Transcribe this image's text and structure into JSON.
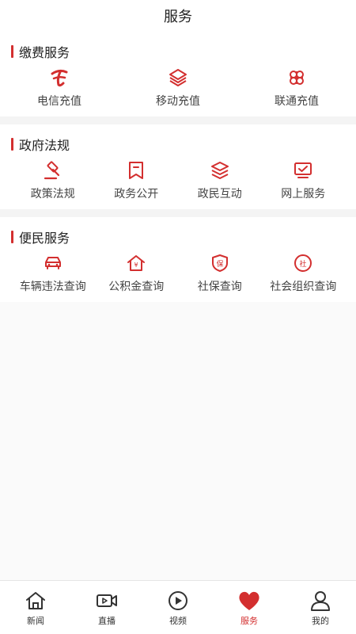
{
  "header": {
    "title": "服务"
  },
  "sections": [
    {
      "title": "缴费服务",
      "items": [
        {
          "label": "电信充值",
          "icon": "china-telecom-icon"
        },
        {
          "label": "移动充值",
          "icon": "china-mobile-icon"
        },
        {
          "label": "联通充值",
          "icon": "china-unicom-icon"
        }
      ]
    },
    {
      "title": "政府法规",
      "items": [
        {
          "label": "政策法规",
          "icon": "gavel-icon"
        },
        {
          "label": "政务公开",
          "icon": "bookmark-icon"
        },
        {
          "label": "政民互动",
          "icon": "layers-icon"
        },
        {
          "label": "网上服务",
          "icon": "monitor-check-icon"
        }
      ]
    },
    {
      "title": "便民服务",
      "items": [
        {
          "label": "车辆违法查询",
          "icon": "car-icon"
        },
        {
          "label": "公积金查询",
          "icon": "house-yen-icon"
        },
        {
          "label": "社保查询",
          "icon": "shield-bao-icon"
        },
        {
          "label": "社会组织查询",
          "icon": "circle-she-icon"
        }
      ]
    }
  ],
  "icon_glyphs": {
    "bao": "保",
    "she": "社",
    "yen": "¥"
  },
  "tabbar": [
    {
      "label": "新闻",
      "icon": "home-icon",
      "active": false
    },
    {
      "label": "直播",
      "icon": "video-camera-icon",
      "active": false
    },
    {
      "label": "视频",
      "icon": "play-circle-icon",
      "active": false
    },
    {
      "label": "服务",
      "icon": "heart-icon",
      "active": true
    },
    {
      "label": "我的",
      "icon": "user-icon",
      "active": false
    }
  ],
  "colors": {
    "accent": "#d32f2f",
    "text": "#444444",
    "divider": "#f4f4f4"
  }
}
